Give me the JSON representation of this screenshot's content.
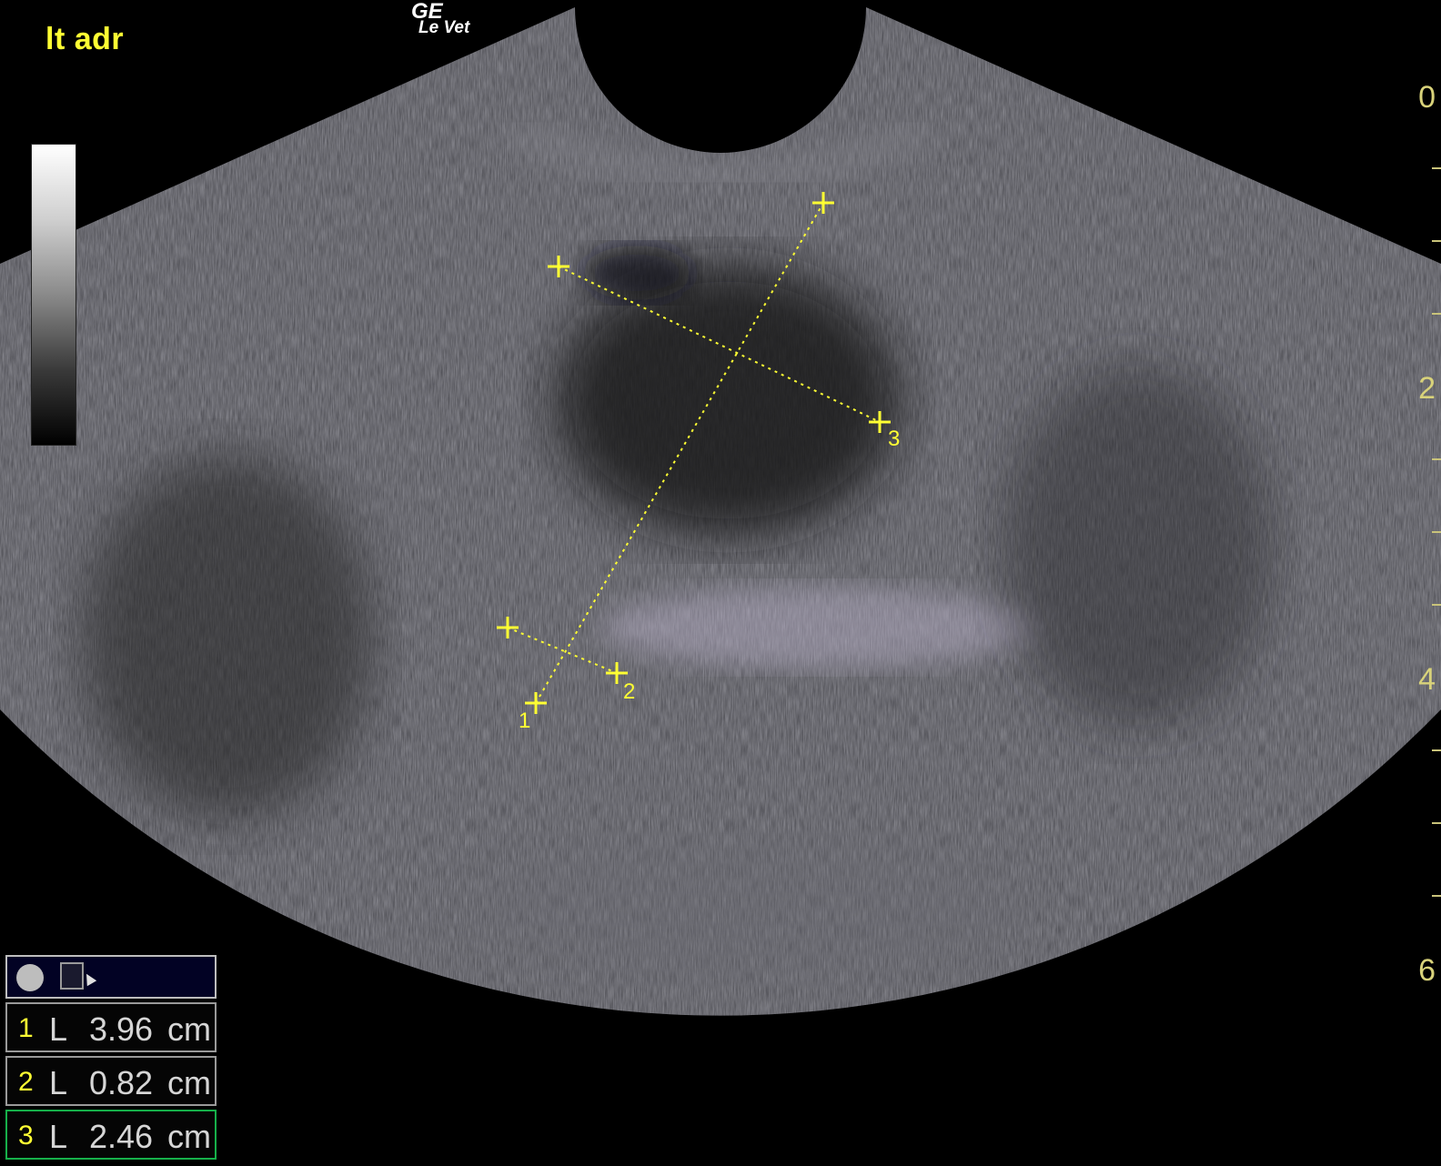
{
  "header": {
    "preset_label": "lt adr",
    "vendor_logo": {
      "line1": "GE",
      "line2": "Le Vet"
    }
  },
  "depth_scale": {
    "labels": [
      "0",
      "2",
      "4",
      "6"
    ],
    "unit": "cm"
  },
  "calipers": [
    {
      "id": "1",
      "label": "1"
    },
    {
      "id": "2",
      "label": "2"
    },
    {
      "id": "3",
      "label": "3"
    }
  ],
  "measurements": {
    "toolbar": {
      "icons": [
        "circle-icon",
        "calculator-icon",
        "cursor-icon"
      ]
    },
    "rows": [
      {
        "index": "1",
        "type": "L",
        "value": "3.96",
        "unit": "cm",
        "active": false
      },
      {
        "index": "2",
        "type": "L",
        "value": "0.82",
        "unit": "cm",
        "active": false
      },
      {
        "index": "3",
        "type": "L",
        "value": "2.46",
        "unit": "cm",
        "active": true
      }
    ]
  },
  "colors": {
    "caliper": "#ffff33",
    "depth_label": "#d8d27a",
    "active_border": "#16b04a"
  }
}
